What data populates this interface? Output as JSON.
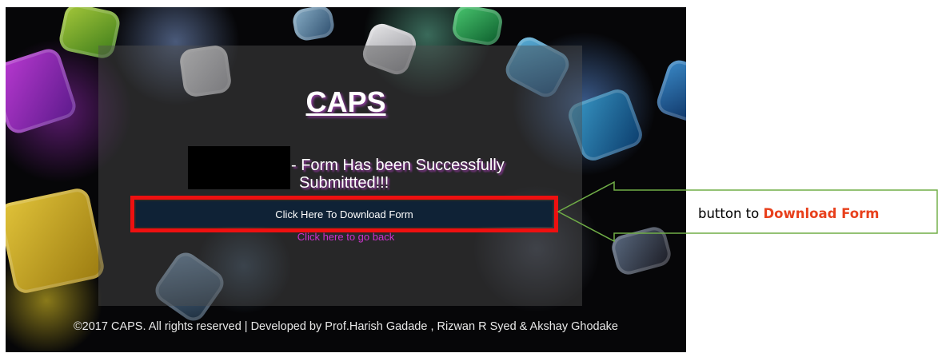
{
  "app": {
    "title": "CAPS",
    "success_message_line1": "- Form Has been Successfully",
    "success_message_line2": "Submittted!!!",
    "download_button_label": "Click Here To Download Form",
    "back_link_label": "Click here to go back",
    "footer_text": "©2017 CAPS. All rights reserved | Developed by Prof.Harish Gadade , Rizwan R Syed & Akshay Ghodake"
  },
  "annotation": {
    "label_prefix": "button to ",
    "label_emphasis": "Download Form",
    "highlight_color": "#ee1010",
    "arrow_color": "#70ad47"
  },
  "colors": {
    "button_bg": "#0f2236",
    "link": "#cc33cc",
    "title_shadow": "#8e3c9e"
  }
}
